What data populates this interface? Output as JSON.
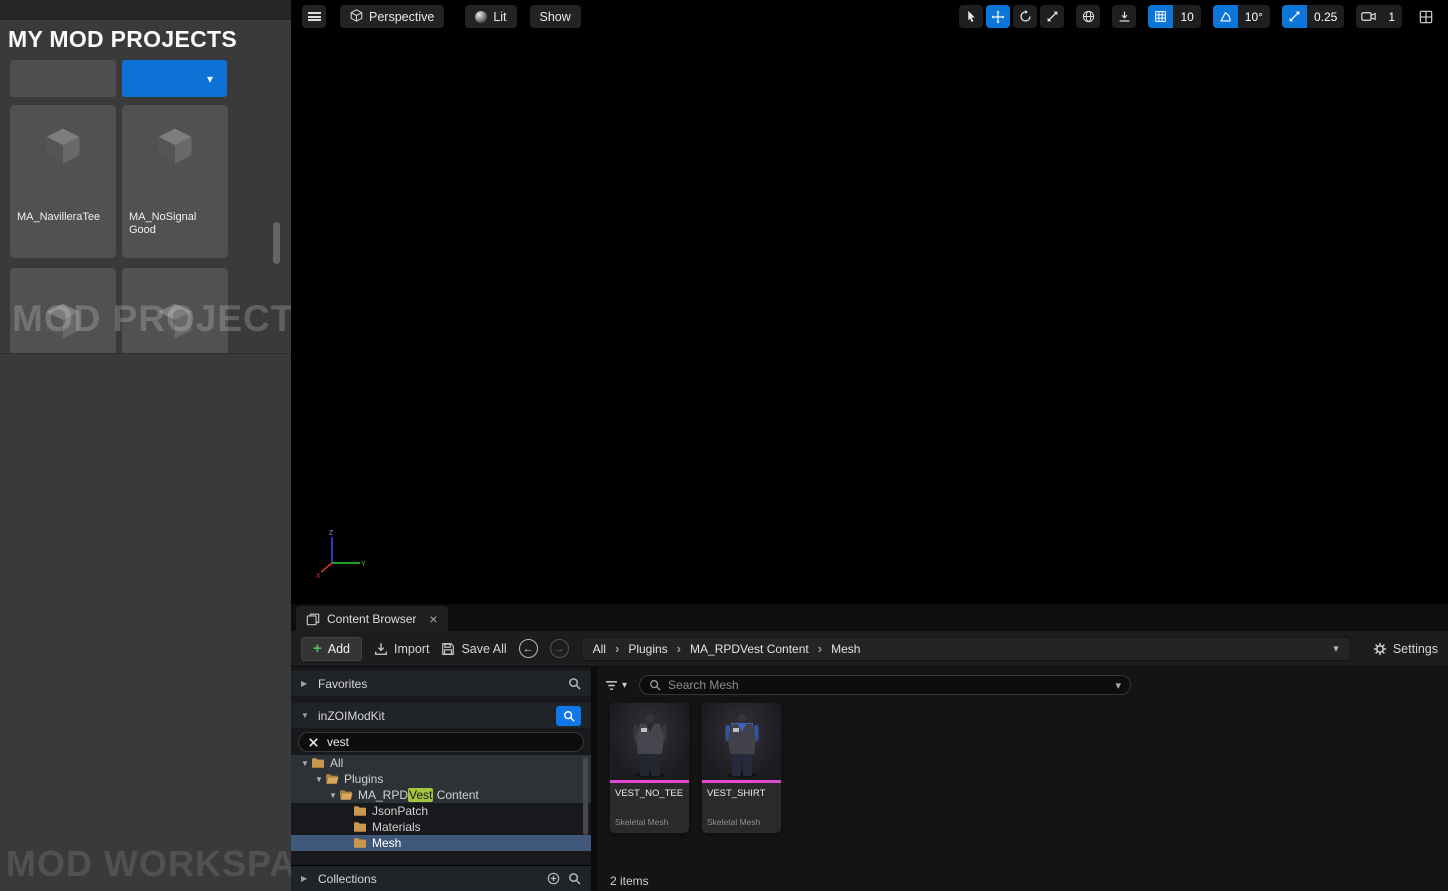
{
  "colors": {
    "accent_blue": "#0d72d6",
    "selection_blue": "#40587a",
    "match_green": "#a6c53e",
    "skeletal_mesh_pink": "#e14bd2"
  },
  "icons": {
    "chevron_down": "▾",
    "arrow_collapsed": "▶",
    "arrow_expanded": "▼",
    "close": "×",
    "back_arrow": "←",
    "forward_arrow": "→",
    "breadcrumb_separator": "›",
    "plus": "+"
  },
  "left_panel": {
    "title": "MY MOD PROJECTS",
    "watermark_middle": "MOD PROJECTS",
    "watermark_bottom": "MOD WORKSPAC",
    "assets": [
      {
        "name": "MA_NavilleraTee"
      },
      {
        "name": "MA_NoSignal Good"
      }
    ]
  },
  "viewport": {
    "perspective_label": "Perspective",
    "lit_label": "Lit",
    "show_label": "Show",
    "grid_snap_value": "10",
    "angle_snap_value": "10°",
    "scale_snap_value": "0.25",
    "camera_speed_value": "1",
    "axis": {
      "x": "X",
      "y": "Y",
      "z": "Z"
    }
  },
  "content_browser": {
    "tab_label": "Content Browser",
    "toolbar": {
      "add_label": "Add",
      "import_label": "Import",
      "save_all_label": "Save All",
      "settings_label": "Settings"
    },
    "breadcrumbs": [
      "All",
      "Plugins",
      "MA_RPDVest Content",
      "Mesh"
    ],
    "favorites_label": "Favorites",
    "source_label": "inZOIModKit",
    "source_search_value": "vest",
    "tree": [
      {
        "label": "All"
      },
      {
        "label": "Plugins"
      },
      {
        "pre": "MA_RPD",
        "match": "Vest",
        "post": " Content"
      },
      {
        "label": "JsonPatch"
      },
      {
        "label": "Materials"
      },
      {
        "label": "Mesh"
      }
    ],
    "collections_label": "Collections",
    "asset_search_placeholder": "Search Mesh",
    "assets": [
      {
        "name": "VEST_NO_TEE",
        "type": "Skeletal Mesh"
      },
      {
        "name": "VEST_SHIRT",
        "type": "Skeletal Mesh"
      }
    ],
    "status_text": "2 items"
  }
}
